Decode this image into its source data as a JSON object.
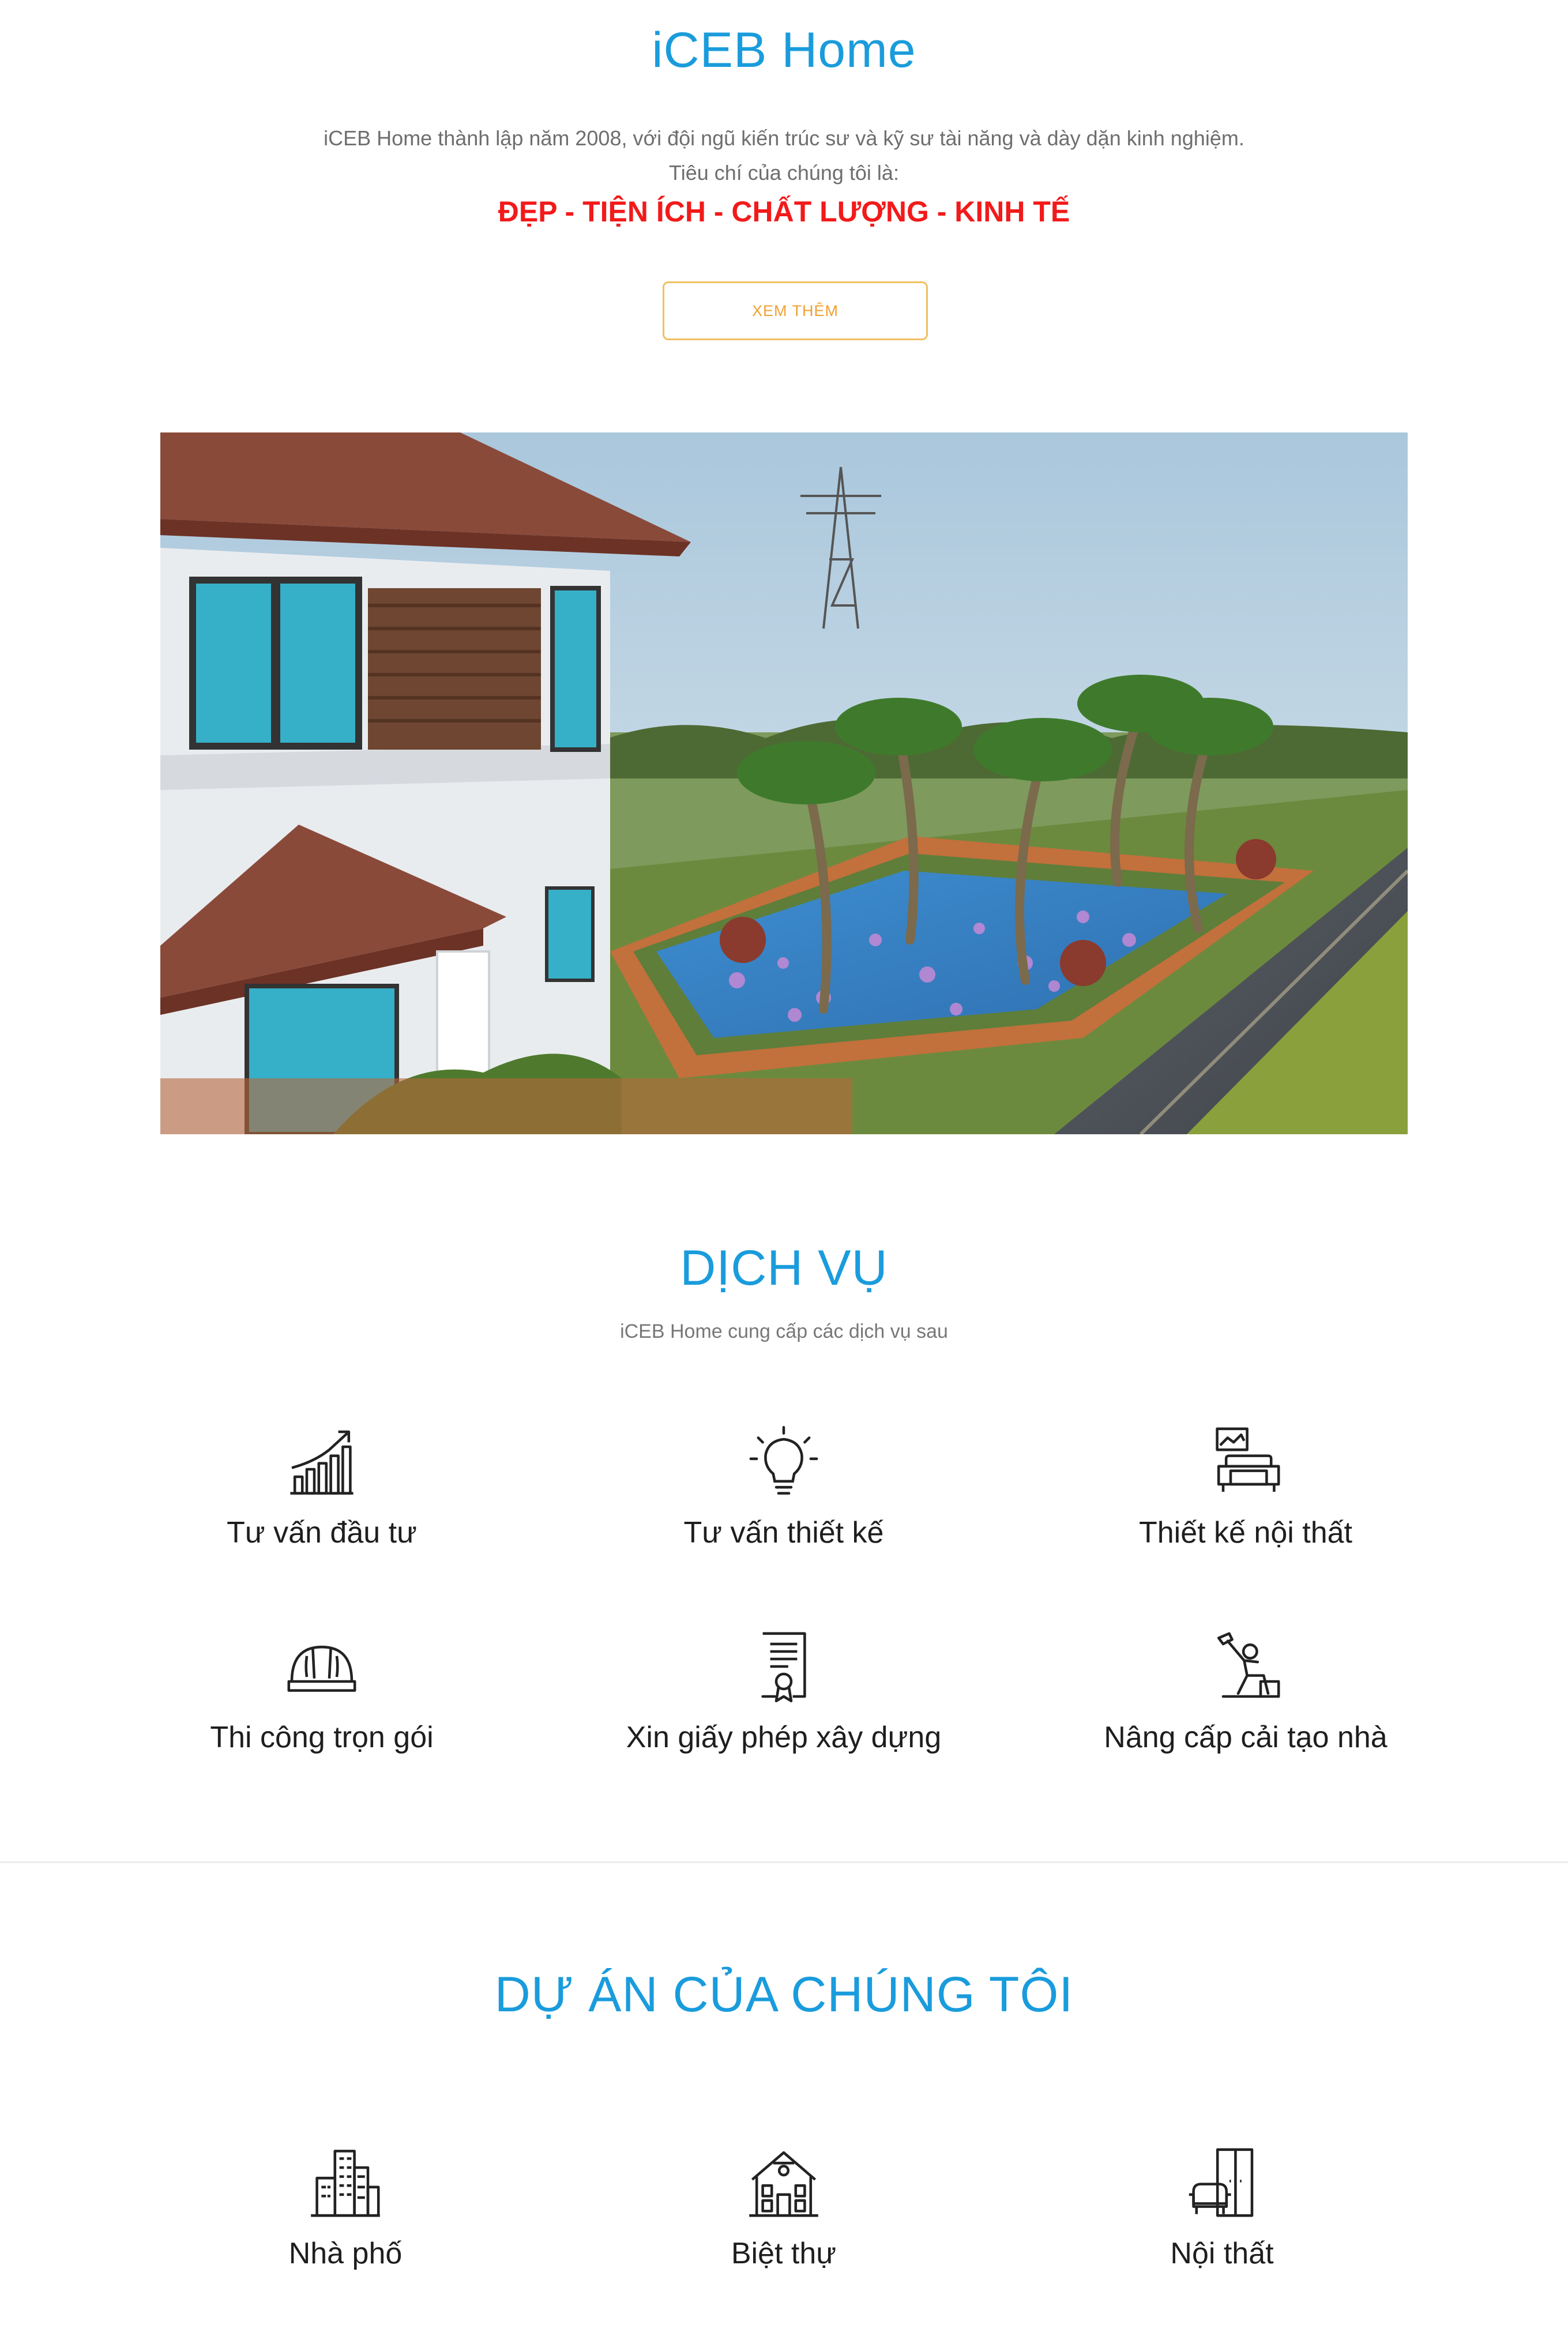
{
  "header": {
    "title": "iCEB Home",
    "intro_line1": "iCEB Home thành lập năm 2008, với đội ngũ kiến trúc sư và kỹ sư tài năng và dày dặn kinh nghiệm.",
    "intro_line2": "Tiêu chí của chúng tôi là:",
    "criteria": "ĐẸP - TIỆN ÍCH - CHẤT LƯỢNG - KINH TẾ",
    "more_button": "XEM THÊM"
  },
  "services": {
    "title": "DỊCH VỤ",
    "subtitle": "iCEB Home cung cấp các dịch vụ sau",
    "items": [
      {
        "label": "Tư vấn đầu tư",
        "icon": "growth-chart-icon"
      },
      {
        "label": "Tư vấn thiết kế",
        "icon": "lightbulb-icon"
      },
      {
        "label": "Thiết kế nội thất",
        "icon": "sofa-icon"
      },
      {
        "label": "Thi công trọn gói",
        "icon": "hard-hat-icon"
      },
      {
        "label": "Xin giấy phép xây dựng",
        "icon": "certificate-icon"
      },
      {
        "label": "Nâng cấp cải tạo nhà",
        "icon": "worker-hammer-icon"
      }
    ]
  },
  "projects": {
    "title": "DỰ ÁN CỦA CHÚNG TÔI",
    "items": [
      {
        "label": "Nhà phố",
        "icon": "city-buildings-icon"
      },
      {
        "label": "Biệt thự",
        "icon": "villa-icon"
      },
      {
        "label": "Nội thất",
        "icon": "armchair-door-icon"
      }
    ]
  },
  "colors": {
    "accent_blue": "#1a9cdc",
    "criteria_red": "#f21a1a",
    "button_border": "#f0c060"
  }
}
